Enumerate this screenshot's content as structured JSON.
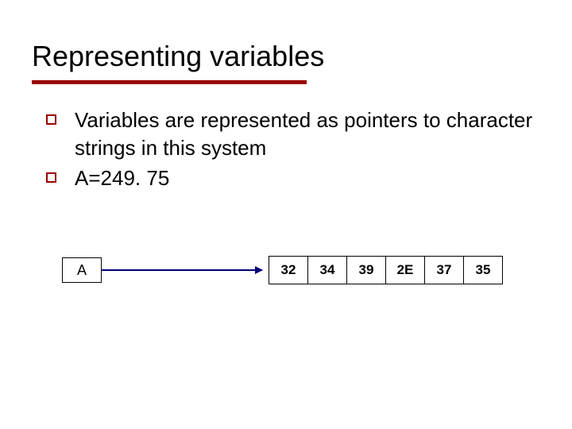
{
  "title": "Representing variables",
  "bullets": [
    "Variables are represented as pointers to character strings in this system",
    "A=249. 75"
  ],
  "diagram": {
    "var_label": "A",
    "bytes": [
      "32",
      "34",
      "39",
      "2E",
      "37",
      "35"
    ]
  }
}
